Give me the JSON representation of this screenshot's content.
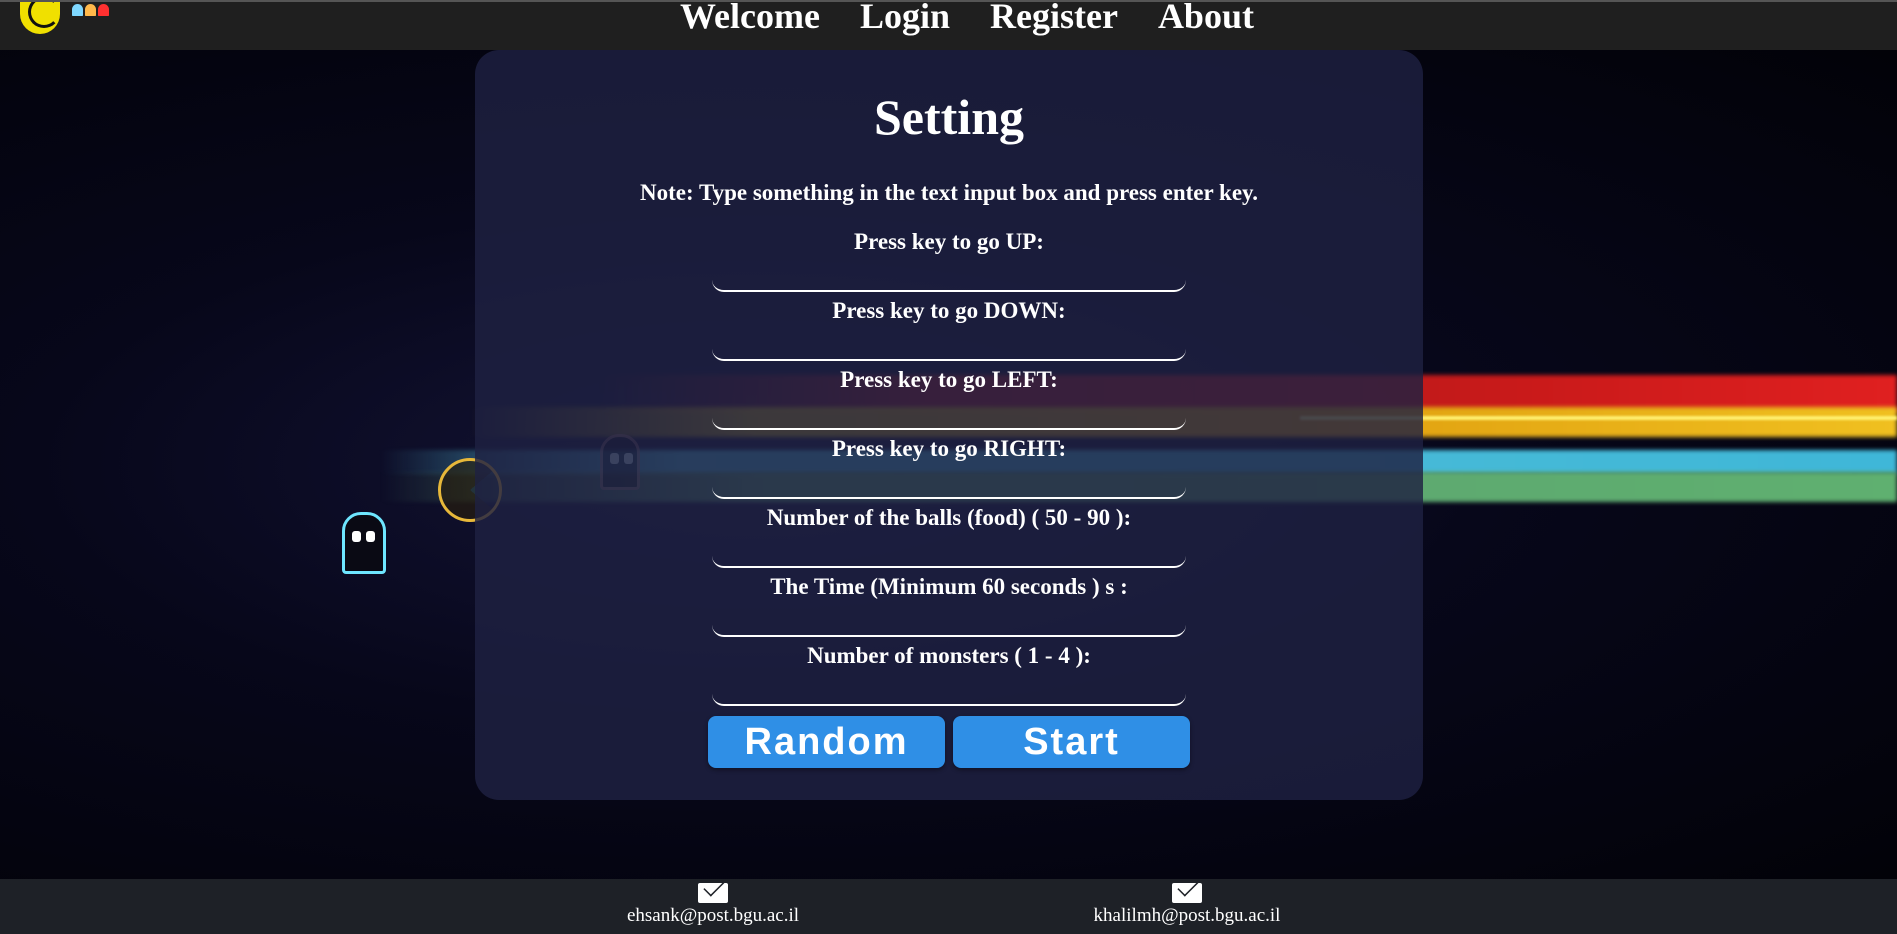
{
  "nav": {
    "items": [
      "Welcome",
      "Login",
      "Register",
      "About"
    ]
  },
  "colors": {
    "header_bg": "#1f1f1f",
    "panel_bg": "#1e2142",
    "button_bg": "#2f8fe6",
    "footer_bg": "#1e2127",
    "logo_yellow": "#f0e000"
  },
  "icons": {
    "logo": "pacman-logo-icon",
    "mini_ghosts": [
      "ghost-blue-icon",
      "ghost-orange-icon",
      "ghost-red-icon"
    ],
    "email": "envelope-icon"
  },
  "settings": {
    "title": "Setting",
    "note": "Note: Type something in the text input box and press enter key.",
    "fields": [
      {
        "label": "Press key to go UP:",
        "value": ""
      },
      {
        "label": "Press key to go DOWN:",
        "value": ""
      },
      {
        "label": "Press key to go LEFT:",
        "value": ""
      },
      {
        "label": "Press key to go RIGHT:",
        "value": ""
      },
      {
        "label": "Number of the balls (food) ( 50 - 90 ):",
        "value": ""
      },
      {
        "label": "The Time (Minimum 60 seconds ) s :",
        "value": ""
      },
      {
        "label": "Number of monsters ( 1 - 4 ):",
        "value": ""
      }
    ],
    "random_label": "Random",
    "start_label": "Start"
  },
  "footer": {
    "contacts": [
      "ehsank@post.bgu.ac.il",
      "khalilmh@post.bgu.ac.il"
    ]
  }
}
